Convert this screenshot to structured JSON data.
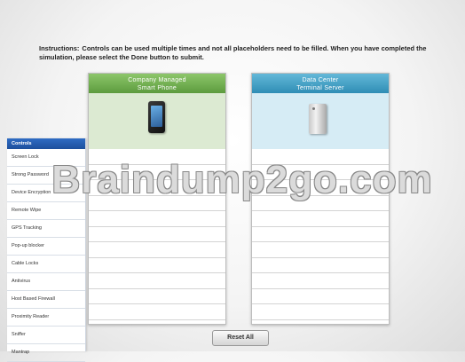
{
  "instructions": {
    "label": "Instructions:",
    "text": "Controls can be used multiple times and not all placeholders need to be filled. When you have completed the simulation, please select the Done button to submit."
  },
  "sidebar": {
    "title": "Controls",
    "items": [
      "Screen Lock",
      "Strong Password",
      "Device Encryption",
      "Remote Wipe",
      "GPS Tracking",
      "Pop-up blocker",
      "Cable Locks",
      "Antivirus",
      "Host Based Firewall",
      "Proximity Reader",
      "Sniffer",
      "Mantrap"
    ]
  },
  "panels": {
    "left": {
      "title_line1": "Company Managed",
      "title_line2": "Smart Phone",
      "icon": "smartphone-icon"
    },
    "right": {
      "title_line1": "Data Center",
      "title_line2": "Terminal Server",
      "icon": "server-icon"
    }
  },
  "watermark": "Braindump2go.com",
  "buttons": {
    "reset_label": "Reset All"
  },
  "colors": {
    "left_header": "#6fae4c",
    "right_header": "#3c9dc4",
    "sidebar_header": "#2459ad"
  }
}
